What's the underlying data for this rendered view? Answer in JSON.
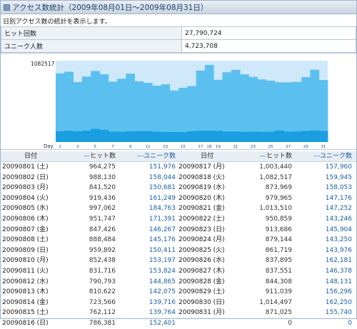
{
  "title": "アクセス数統計（2009年08月01日～2009年08月31日）",
  "description": "日別アクセス数の統計を表示します。",
  "summary": [
    {
      "label": "ヒット回数",
      "value": "27,790,724"
    },
    {
      "label": "ユニーク人数",
      "value": "4,723,708"
    }
  ],
  "table_headers": {
    "date": "日付",
    "hits": "ヒット数",
    "unique": "ユニーク数"
  },
  "rows": [
    {
      "date": "20090801 (土)",
      "hits": "964,275",
      "unique": "151,976"
    },
    {
      "date": "20090802 (日)",
      "hits": "988,130",
      "unique": "158,044"
    },
    {
      "date": "20090803 (月)",
      "hits": "841,520",
      "unique": "150,681"
    },
    {
      "date": "20090804 (火)",
      "hits": "919,436",
      "unique": "161,249"
    },
    {
      "date": "20090805 (水)",
      "hits": "997,062",
      "unique": "184,763"
    },
    {
      "date": "20090806 (木)",
      "hits": "951,747",
      "unique": "171,391"
    },
    {
      "date": "20090807 (金)",
      "hits": "847,426",
      "unique": "146,267"
    },
    {
      "date": "20090808 (土)",
      "hits": "888,484",
      "unique": "145,176"
    },
    {
      "date": "20090809 (日)",
      "hits": "959,892",
      "unique": "150,411"
    },
    {
      "date": "20090810 (月)",
      "hits": "852,438",
      "unique": "153,197"
    },
    {
      "date": "20090811 (火)",
      "hits": "831,716",
      "unique": "153,824"
    },
    {
      "date": "20090812 (水)",
      "hits": "790,793",
      "unique": "144,865"
    },
    {
      "date": "20090813 (木)",
      "hits": "810,622",
      "unique": "142,075"
    },
    {
      "date": "20090814 (金)",
      "hits": "723,566",
      "unique": "139,716"
    },
    {
      "date": "20090815 (土)",
      "hits": "762,112",
      "unique": "139,764"
    },
    {
      "date": "20090816 (日)",
      "hits": "786,381",
      "unique": "152,401"
    },
    {
      "date": "20090817 (月)",
      "hits": "1,003,440",
      "unique": "157,960"
    },
    {
      "date": "20090818 (火)",
      "hits": "1,082,517",
      "unique": "159,945"
    },
    {
      "date": "20090819 (水)",
      "hits": "873,969",
      "unique": "158,053"
    },
    {
      "date": "20090820 (木)",
      "hits": "979,965",
      "unique": "147,176"
    },
    {
      "date": "20090821 (金)",
      "hits": "1,013,510",
      "unique": "147,252"
    },
    {
      "date": "20090822 (土)",
      "hits": "950,859",
      "unique": "143,246"
    },
    {
      "date": "20090823 (日)",
      "hits": "913,686",
      "unique": "145,904"
    },
    {
      "date": "20090824 (月)",
      "hits": "879,144",
      "unique": "143,250"
    },
    {
      "date": "20090825 (火)",
      "hits": "861,719",
      "unique": "143,976"
    },
    {
      "date": "20090826 (水)",
      "hits": "837,895",
      "unique": "162,181"
    },
    {
      "date": "20090827 (木)",
      "hits": "837,551",
      "unique": "146,378"
    },
    {
      "date": "20090828 (金)",
      "hits": "844,308",
      "unique": "148,131"
    },
    {
      "date": "20090829 (土)",
      "hits": "911,039",
      "unique": "156,296"
    },
    {
      "date": "20090830 (日)",
      "hits": "1,014,497",
      "unique": "162,250"
    },
    {
      "date": "20090831 (月)",
      "hits": "871,025",
      "unique": "155,740"
    },
    {
      "date": "",
      "hits": "0",
      "unique": "0"
    }
  ],
  "chart_data": {
    "type": "bar",
    "xlabel": "Day",
    "ymax_label": "1082517",
    "ylim": [
      0,
      1082517
    ],
    "categories": [
      "1",
      "2",
      "3",
      "4",
      "5",
      "6",
      "7",
      "8",
      "9",
      "10",
      "11",
      "12",
      "13",
      "14",
      "15",
      "16",
      "17",
      "18",
      "19",
      "20",
      "21",
      "22",
      "23",
      "24",
      "25",
      "26",
      "27",
      "28",
      "29",
      "30",
      "31"
    ],
    "series": [
      {
        "name": "ヒット数",
        "color": "#5bc0f0",
        "values": [
          964275,
          988130,
          841520,
          919436,
          997062,
          951747,
          847426,
          888484,
          959892,
          852438,
          831716,
          790793,
          810622,
          723566,
          762112,
          786381,
          1003440,
          1082517,
          873969,
          979965,
          1013510,
          950859,
          913686,
          879144,
          861719,
          837895,
          837551,
          844308,
          911039,
          1014497,
          871025
        ]
      },
      {
        "name": "ユニーク数",
        "color": "#1a9ee0",
        "values": [
          151976,
          158044,
          150681,
          161249,
          184763,
          171391,
          146267,
          145176,
          150411,
          153197,
          153824,
          144865,
          142075,
          139716,
          139764,
          152401,
          157960,
          159945,
          158053,
          147176,
          147252,
          143246,
          145904,
          143250,
          143976,
          162181,
          146378,
          148131,
          156296,
          162250,
          155740
        ]
      }
    ]
  }
}
